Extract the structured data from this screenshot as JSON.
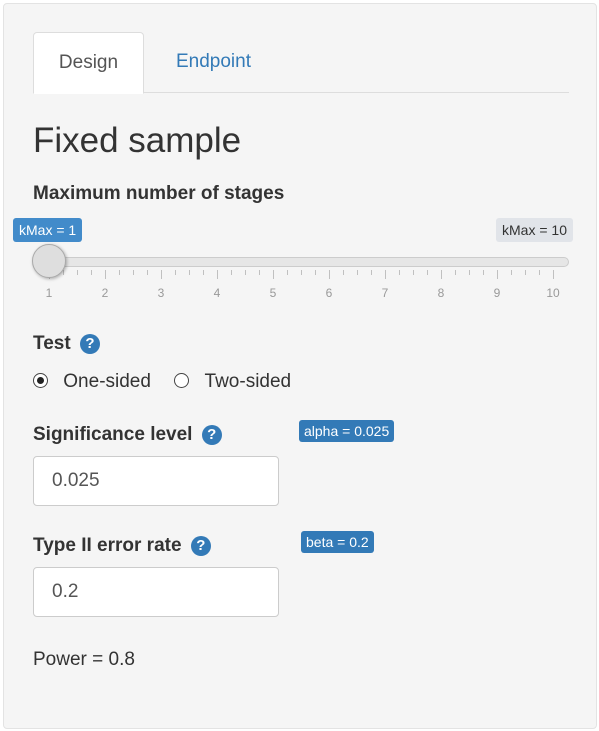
{
  "tabs": [
    {
      "label": "Design",
      "active": true
    },
    {
      "label": "Endpoint",
      "active": false
    }
  ],
  "title": "Fixed sample",
  "stages": {
    "label": "Maximum number of stages",
    "from_label": "kMax = 1",
    "max_label": "kMax = 10",
    "value": 1,
    "min": 1,
    "max": 10,
    "tick_labels": [
      "1",
      "2",
      "3",
      "4",
      "5",
      "6",
      "7",
      "8",
      "9",
      "10"
    ]
  },
  "test": {
    "label": "Test",
    "help_icon": "question-circle-icon",
    "options": [
      {
        "label": "One-sided",
        "checked": true
      },
      {
        "label": "Two-sided",
        "checked": false
      }
    ]
  },
  "significance": {
    "label": "Significance level",
    "badge": "alpha = 0.025",
    "value": "0.025"
  },
  "type2": {
    "label": "Type II error rate",
    "badge": "beta = 0.2",
    "value": "0.2"
  },
  "power": "Power = 0.8",
  "colors": {
    "accent": "#337ab7",
    "slider_bubble": "#428bca",
    "panel_bg": "#f5f5f5"
  }
}
